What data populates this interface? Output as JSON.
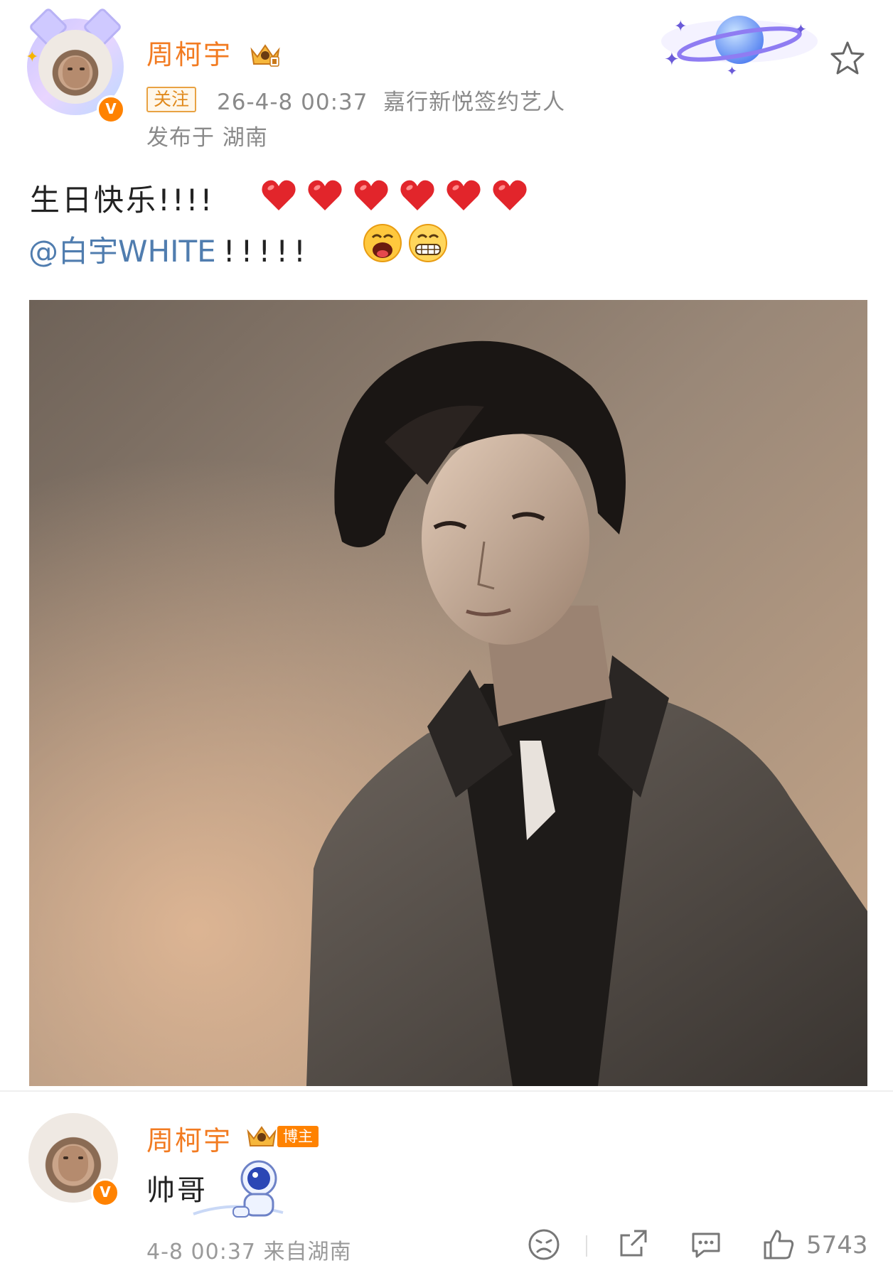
{
  "post": {
    "author": "周柯宇",
    "follow_label": "关注",
    "meta_line": "26-4-8 00:37  嘉行新悦签约艺人",
    "location_line": "发布于 湖南",
    "text_line1": "生日快乐!!!!",
    "heart_count": 6,
    "mention": "@白宇WHITE",
    "mention_suffix": "!!!!!",
    "verified_badge": "V"
  },
  "comment": {
    "author": "周柯宇",
    "role_badge": "博主",
    "text": "帅哥",
    "time_source": "4-8 00:37 来自湖南",
    "like_count": "5743",
    "verified_badge": "V"
  },
  "icons": {
    "favorite": "star-outline-icon",
    "dislike": "sad-face-icon",
    "share": "share-icon",
    "comment": "comment-icon",
    "like": "thumbs-up-icon"
  },
  "colors": {
    "username": "#f27b21",
    "mention": "#507daf",
    "meta": "#8a8a8a",
    "badge": "#ff8200"
  }
}
